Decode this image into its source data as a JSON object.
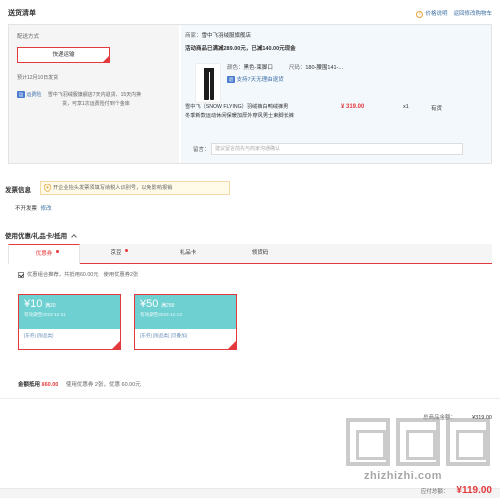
{
  "header": {
    "title": "送货清单",
    "price_note": "价格说明",
    "back_cart": "返回修改购物车"
  },
  "shipping": {
    "method_label": "配送方式",
    "method_button": "快递运输",
    "delivery_note": "预计12月10日发货",
    "tag": "运",
    "freight_insurance": "运费险",
    "freight_desc_1": "雪中飞羽绒服旗舰店7天内退货、15天内换",
    "freight_desc_2": "货，可享1次运费险付到个金库"
  },
  "store": {
    "seller_label": "商家：",
    "seller_name": "雪中飞羽绒服旗舰店",
    "promo": "活动商品已满减289.00元，已减140.00元现金",
    "color_label": "颜色：",
    "color_value": "黑色-束脚口",
    "size_label": "尺码：",
    "size_value": "180-腰围141-...",
    "return_icon": "退",
    "return_text": "支持7天无理由退货",
    "product_name_1": "雪中飞（SNOW FLYING）羽绒裤白鸭绒裤男",
    "product_name_2": "冬季新款运动休闲保暖加厚外穿风男士束脚长裤",
    "price": "¥ 319.00",
    "qty": "x1",
    "stock": "有货",
    "remark_label": "留言：",
    "remark_placeholder": "建议留言前先与商家沟通确认"
  },
  "invoice": {
    "title": "发票信息",
    "notice": "开企业抬头发票须填写纳税人识别号，以免影响报销",
    "status": "不开发票",
    "modify": "修改"
  },
  "discount": {
    "title": "使用优惠/礼品卡/抵用",
    "tabs": [
      "优惠券",
      "京豆",
      "礼品卡",
      "领货码"
    ],
    "checkbox_text": "优惠组合推荐，共抵用60.00元",
    "use_text": "使用优惠券2张"
  },
  "coupons": [
    {
      "amount": "¥10",
      "condition": "满20",
      "date": "有效期至2023-12-31",
      "links": "[东券]  [限品类]"
    },
    {
      "amount": "¥50",
      "condition": "满299",
      "date": "有效期至2023-12-13",
      "links": "[东券]  [限品类]  [可叠加]"
    }
  ],
  "deduction": {
    "label": "金额抵用",
    "amount": "¥60.00",
    "desc": "使用优惠券 2张，优惠 60.00元"
  },
  "summary": {
    "goods_label": "总商品金额：",
    "goods_value": "¥319.00",
    "pay_label": "应付总额：",
    "pay_value": "¥119.00"
  },
  "watermark": {
    "text": "zhizhizhi.com"
  },
  "colors": {
    "accent": "#e4393c",
    "coupon": "#6fd0d2",
    "link": "#3b6ea5"
  }
}
